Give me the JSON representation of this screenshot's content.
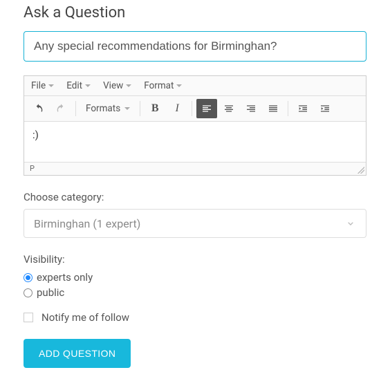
{
  "heading": "Ask a Question",
  "question_value": "Any special recommendations for Birminghan?",
  "menubar": {
    "file": "File",
    "edit": "Edit",
    "view": "View",
    "format": "Format"
  },
  "toolbar": {
    "formats": "Formats"
  },
  "editor_content": ":)",
  "editor_path": "P",
  "category_label": "Choose category:",
  "category_selected": "Birminghan (1 expert)",
  "visibility_label": "Visibility:",
  "visibility_options": {
    "experts": "experts only",
    "public": "public"
  },
  "visibility_selected": "experts",
  "notify_label": "Notify me of follow",
  "notify_checked": false,
  "submit_label": "ADD QUESTION"
}
